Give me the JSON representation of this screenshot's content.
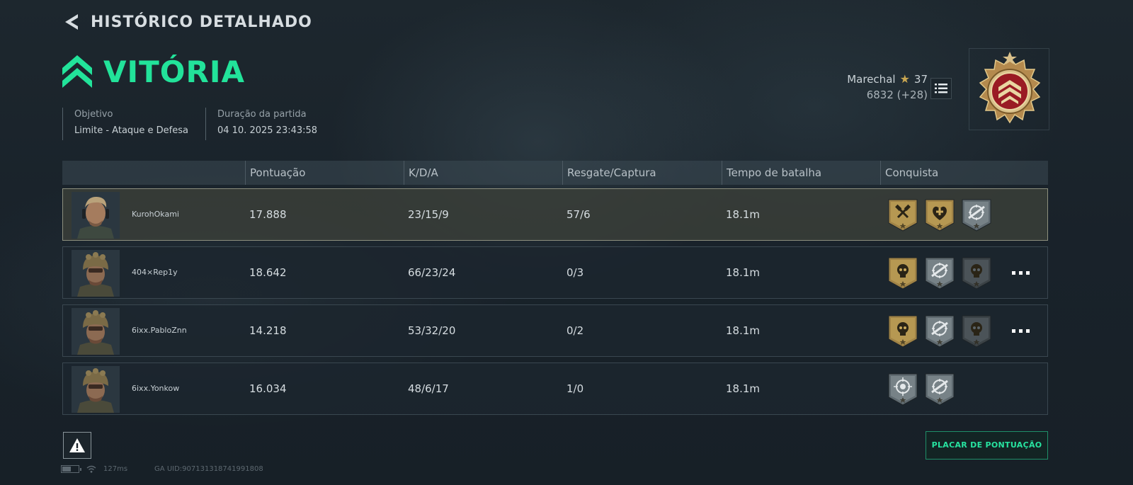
{
  "header": {
    "back_title": "HISTÓRICO DETALHADO",
    "result": "VITÓRIA"
  },
  "meta": {
    "objective_label": "Objetivo",
    "objective_value": "Limite - Ataque e Defesa",
    "duration_label": "Duração da partida",
    "duration_value": "04 10. 2025 23:43:58"
  },
  "rank": {
    "title": "Marechal",
    "level": "37",
    "xp": "6832 (+28)"
  },
  "table": {
    "headers": [
      "Pontuação",
      "K/D/A",
      "Resgate/Captura",
      "Tempo de batalha",
      "Conquista"
    ],
    "rows": [
      {
        "name": "KurohOkami",
        "score": "17.888",
        "kda": "23/15/9",
        "rescue": "57/6",
        "time": "18.1m",
        "badges": [
          "gold-hammer-badge",
          "gold-medic-badge",
          "silver-sniper-badge"
        ],
        "more": false,
        "highlight": true
      },
      {
        "name": "404×Rep1y",
        "score": "18.642",
        "kda": "66/23/24",
        "rescue": "0/3",
        "time": "18.1m",
        "badges": [
          "gold-skull-badge",
          "silver-sniper-badge",
          "dark-skull-badge"
        ],
        "more": true,
        "highlight": false
      },
      {
        "name": "6ixx.PabloZnn",
        "score": "14.218",
        "kda": "53/32/20",
        "rescue": "0/2",
        "time": "18.1m",
        "badges": [
          "gold-skull-badge",
          "silver-sniper-badge",
          "dark-skull-badge"
        ],
        "more": true,
        "highlight": false
      },
      {
        "name": "6ixx.Yonkow",
        "score": "16.034",
        "kda": "48/6/17",
        "rescue": "1/0",
        "time": "18.1m",
        "badges": [
          "silver-crosshair-badge",
          "silver-sniper-badge"
        ],
        "more": false,
        "highlight": false
      }
    ]
  },
  "footer": {
    "score_button": "PLACAR DE PONTUAÇÃO",
    "ping": "127ms",
    "uid": "GA UID:907131318741991808"
  },
  "colors": {
    "accent_green": "#22e39a",
    "gold": "#c9a651",
    "background": "#1b252c"
  }
}
